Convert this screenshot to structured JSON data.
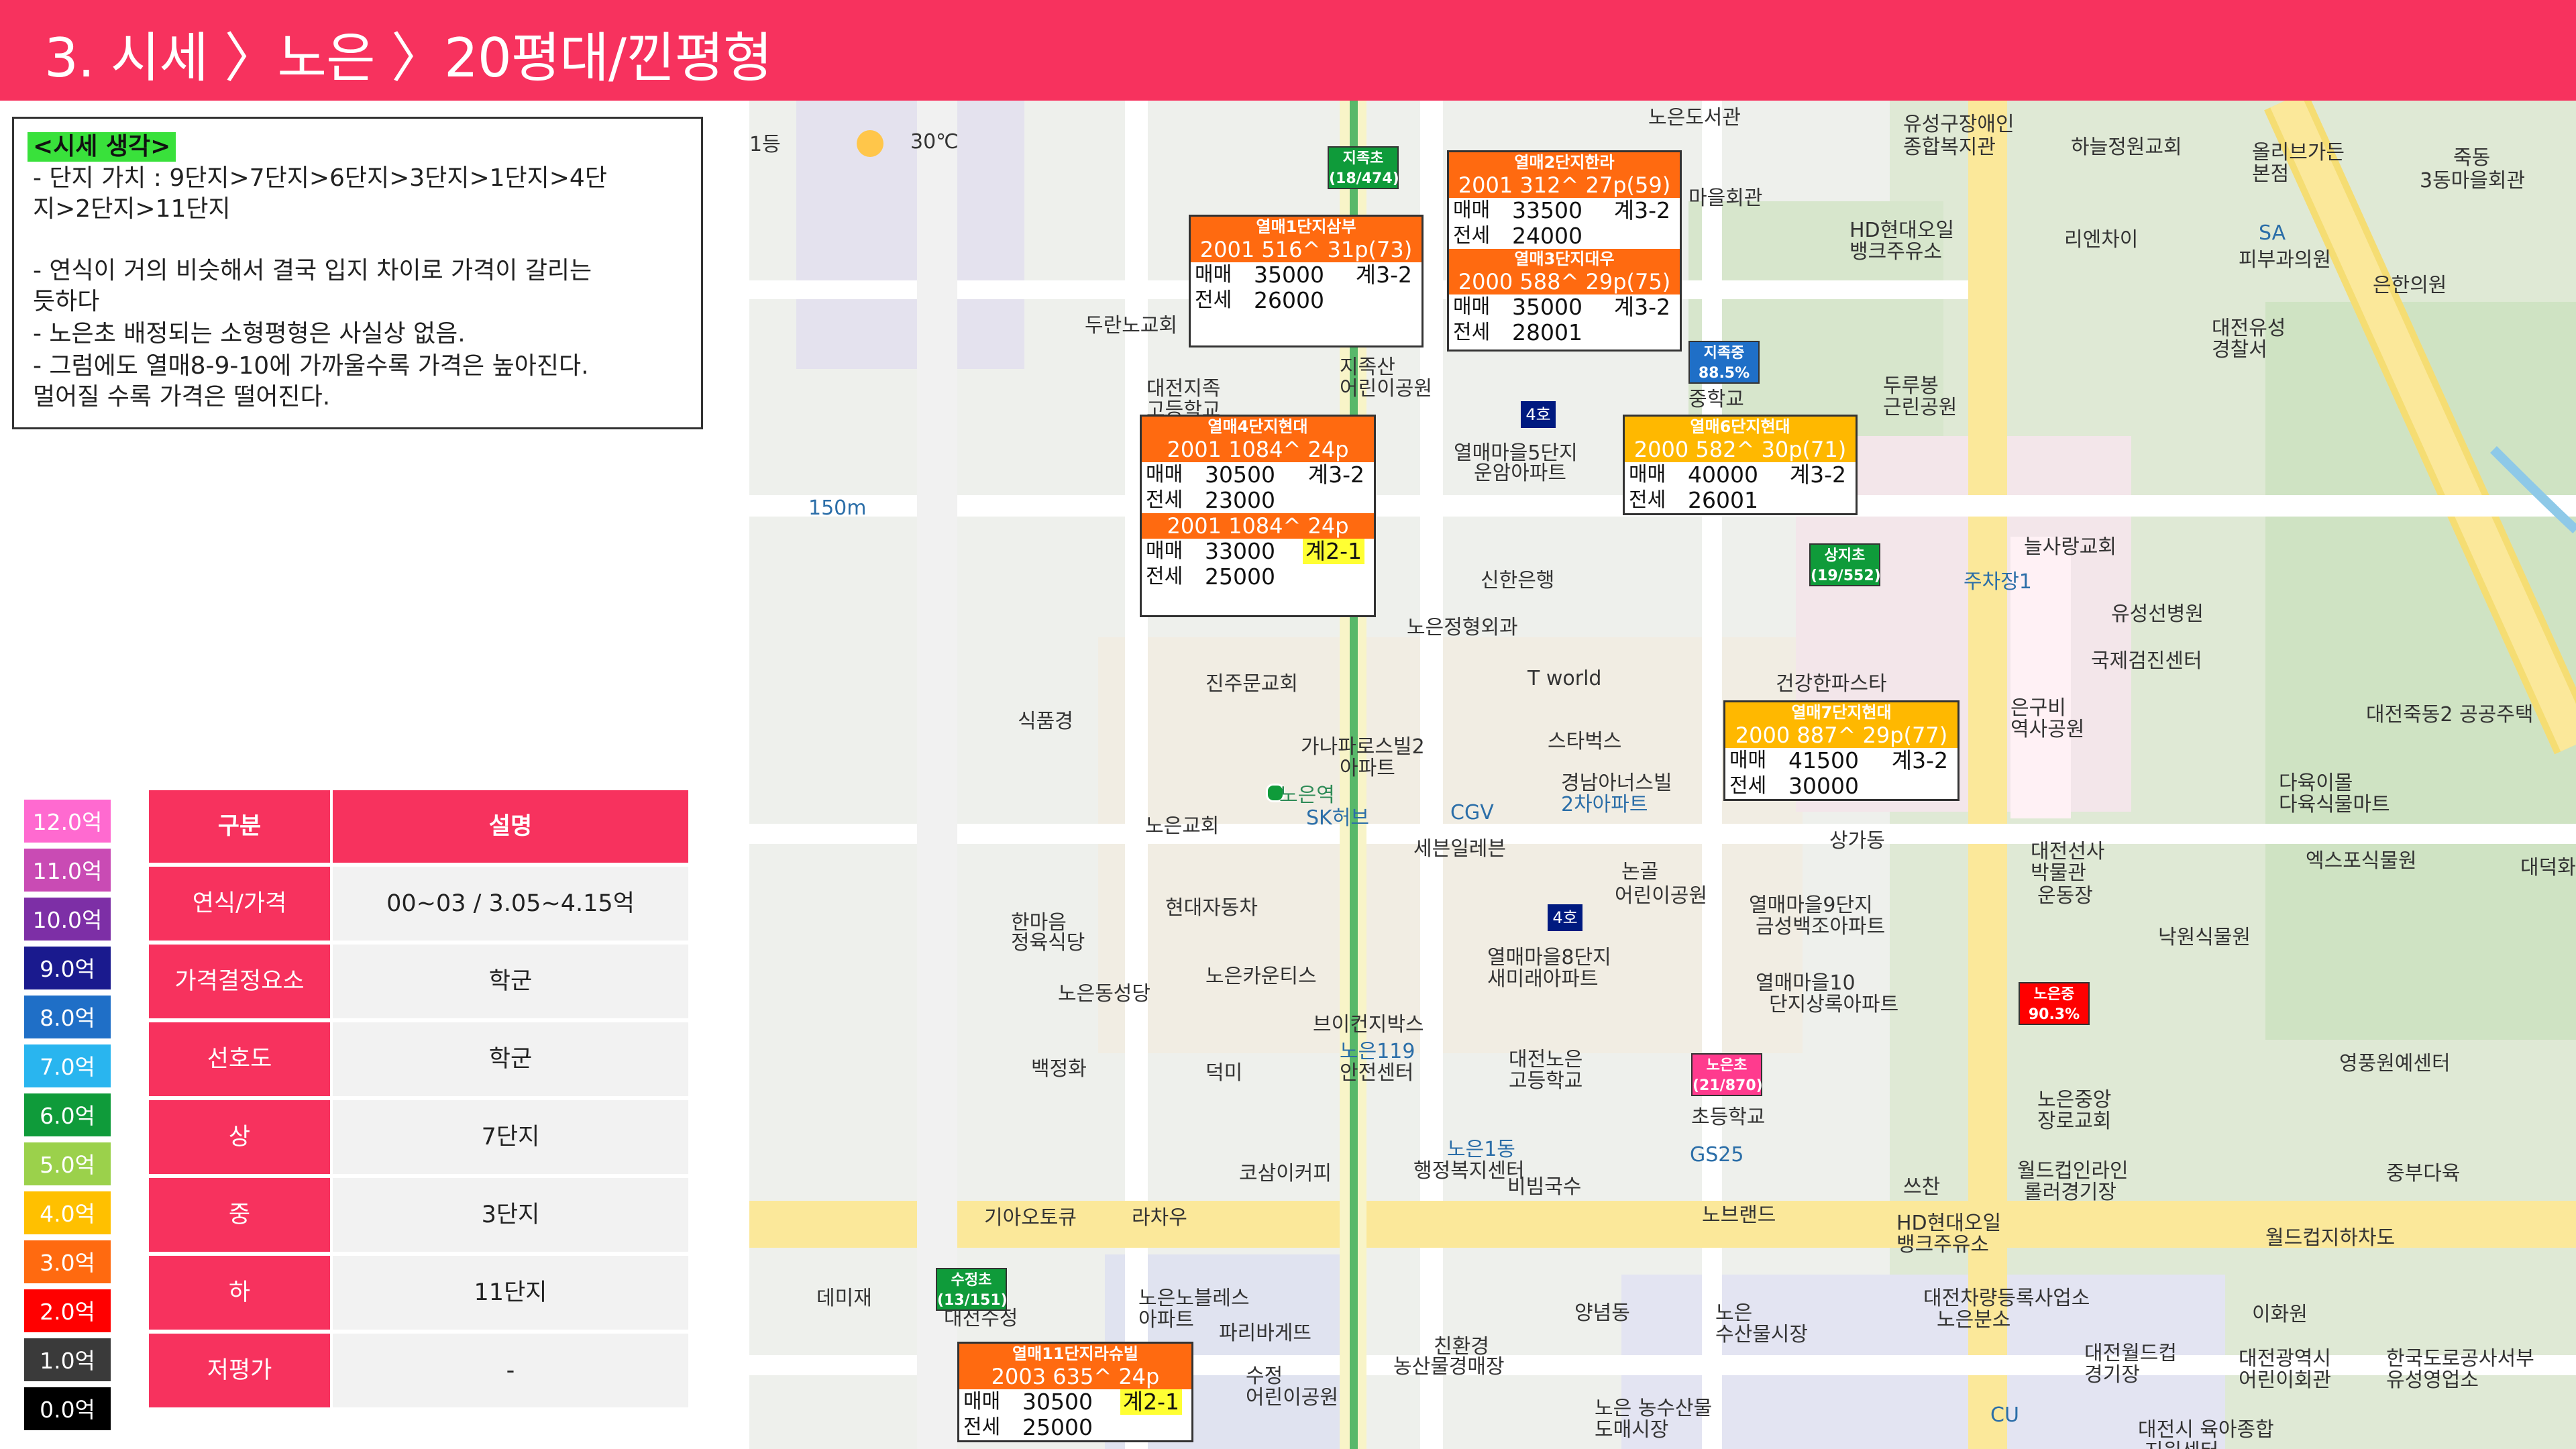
{
  "header": {
    "title": "3. 시세 〉노은 〉20평대/낀평형"
  },
  "notes": {
    "heading": "<시세 생각>",
    "lines": [
      "-   단지 가치 : 9단지>7단지>6단지>3단지>1단지>4단",
      "    지>2단지>11단지",
      "-   연식이 거의 비슷해서 결국 입지 차이로 가격이 갈리는",
      "    듯하다",
      "-   노은초 배정되는 소형평형은 사실상 없음.",
      "-   그럼에도 열매8-9-10에 가까울수록 가격은 높아진다.",
      "    멀어질 수록 가격은 떨어진다."
    ]
  },
  "legend": [
    {
      "label": "12.0억",
      "color": "#ff6ad0"
    },
    {
      "label": "11.0억",
      "color": "#c94bb4"
    },
    {
      "label": "10.0억",
      "color": "#7d2fa6"
    },
    {
      "label": "9.0억",
      "color": "#1a1a8e"
    },
    {
      "label": "8.0억",
      "color": "#1f6fc7"
    },
    {
      "label": "7.0억",
      "color": "#29b5ef"
    },
    {
      "label": "6.0억",
      "color": "#0f9b3a"
    },
    {
      "label": "5.0억",
      "color": "#9bd14b"
    },
    {
      "label": "4.0억",
      "color": "#ffc000"
    },
    {
      "label": "3.0억",
      "color": "#ff6a10"
    },
    {
      "label": "2.0억",
      "color": "#ff0000"
    },
    {
      "label": "1.0억",
      "color": "#3a3a3a"
    },
    {
      "label": "0.0억",
      "color": "#000000"
    }
  ],
  "table": {
    "header": {
      "col1": "구분",
      "col2": "설명"
    },
    "rows": [
      {
        "label": "연식/가격",
        "value": "00~03 / 3.05~4.15억"
      },
      {
        "label": "가격결정요소",
        "value": "학군"
      },
      {
        "label": "선호도",
        "value": "학군"
      },
      {
        "label": "상",
        "value": "7단지"
      },
      {
        "label": "중",
        "value": "3단지"
      },
      {
        "label": "하",
        "value": "11단지"
      },
      {
        "label": "저평가",
        "value": "-"
      }
    ]
  },
  "weather": {
    "temp": "30℃",
    "prefix": "1등"
  },
  "map_labels": [
    "노은도서관",
    "유성구장애인",
    "종합복지관",
    "하늘정원교회",
    "올리브가든",
    "본점",
    "죽동",
    "3동마을회관",
    "마을회관",
    "HD현대오일",
    "뱅크주유소",
    "리엔차이",
    "SA",
    "피부과의원",
    "은한의원",
    "대전유성",
    "경찰서",
    "두란노교회",
    "대전지족",
    "고등학교",
    "지족산",
    "어린이공원",
    "중학교",
    "두루봉",
    "근린공원",
    "열매마을5단지",
    "운암아파트",
    "150m",
    "신한은행",
    "늘사랑교회",
    "주차장1",
    "유성선병원",
    "노은정형외과",
    "진주문교회",
    "식품경",
    "T world",
    "건강한파스타",
    "국제검진센터",
    "대전죽동2 공공주택",
    "은구비",
    "역사공원",
    "가나파로스빌2",
    "아파트",
    "스타벅스",
    "경남아너스빌",
    "2차아파트",
    "다육이몰",
    "다육식물마트",
    "노은교회",
    "SK허브",
    "CGV",
    "세븐일레븐",
    "상가동",
    "엑스포식물원",
    "대덕화훼",
    "대전선사",
    "박물관",
    "운동장",
    "논골",
    "어린이공원",
    "열매마을9단지",
    "금성백조아파트",
    "현대자동차",
    "한마음",
    "정육식당",
    "열매마을8단지",
    "새미래아파트",
    "노은카운티스",
    "낙원식물원",
    "노은동성당",
    "열매마을10",
    "단지상록아파트",
    "브이컨지박스",
    "노은119",
    "안전센터",
    "덕미",
    "백정화",
    "대전노은",
    "고등학교",
    "초등학교",
    "노은중앙",
    "장로교회",
    "영풍원예센터",
    "노은1동",
    "행정복지센터",
    "코삼이커피",
    "GS25",
    "비빔국수",
    "쓰찬",
    "월드컵인라인",
    "롤러경기장",
    "중부다육",
    "기아오토큐",
    "라차우",
    "노브랜드",
    "HD현대오일",
    "뱅크주유소",
    "월드컵지하차도",
    "데미재",
    "대전수정",
    "노은노블레스",
    "아파트",
    "대전차량등록사업소",
    "노은분소",
    "이화원",
    "파리바게뜨",
    "양념동",
    "노은",
    "수산물시장",
    "대전월드컵",
    "경기장",
    "대전광역시",
    "어린이회관",
    "한국도로공사서부",
    "유성영업소",
    "친환경",
    "농산물경매장",
    "수정",
    "어린이공원",
    "노은 농수산물",
    "도매시장",
    "CU",
    "대전시 육아종합",
    "지원센터"
  ],
  "listings": [
    {
      "title": "열매1단지삼부",
      "info": "2001 516^ 31p(73)",
      "sale": "35000",
      "sale_cls": "계3-2",
      "jeonse": "26000"
    },
    {
      "title": "열매2단지한라",
      "info": "2001 312^ 27p(59)",
      "sale": "33500",
      "sale_cls": "계3-2",
      "jeonse": "24000"
    },
    {
      "title": "열매3단지대우",
      "info": "2000 588^ 29p(75)",
      "sale": "35000",
      "sale_cls": "계3-2",
      "jeonse": "28001"
    },
    {
      "title": "열매4단지현대",
      "info": "2001 1084^ 24p",
      "sale": "30500",
      "sale_cls": "계3-2",
      "jeonse": "23000",
      "info2": "2001 1084^ 24p",
      "sale2": "33000",
      "sale2_cls": "계2-1",
      "jeonse2": "25000"
    },
    {
      "title": "열매6단지현대",
      "info": "2000 582^ 30p(71)",
      "sale": "40000",
      "sale_cls": "계3-2",
      "jeonse": "26001"
    },
    {
      "title": "열매7단지현대",
      "info": "2000 887^ 29p(77)",
      "sale": "41500",
      "sale_cls": "계3-2",
      "jeonse": "30000"
    },
    {
      "title": "열매11단지라슈빌",
      "info": "2003 635^ 24p",
      "sale": "30500",
      "sale_cls": "계2-1",
      "jeonse": "25000"
    }
  ],
  "row_labels": {
    "sale": "매매",
    "jeonse": "전세"
  },
  "schools": [
    {
      "name": "지족초",
      "stat": "(18/474)",
      "color": "#0f9b3a"
    },
    {
      "name": "지족중",
      "stat": "88.5%",
      "color": "#1f6fc7"
    },
    {
      "name": "상지초",
      "stat": "(19/552)",
      "color": "#0f9b3a"
    },
    {
      "name": "노은초",
      "stat": "(21/870)",
      "color": "#ff3b8e"
    },
    {
      "name": "노은중",
      "stat": "90.3%",
      "color": "#ff0000"
    },
    {
      "name": "수정초",
      "stat": "(13/151)",
      "color": "#0f9b3a"
    }
  ],
  "map_pins": [
    "4호",
    "4호"
  ],
  "station": "노은역"
}
